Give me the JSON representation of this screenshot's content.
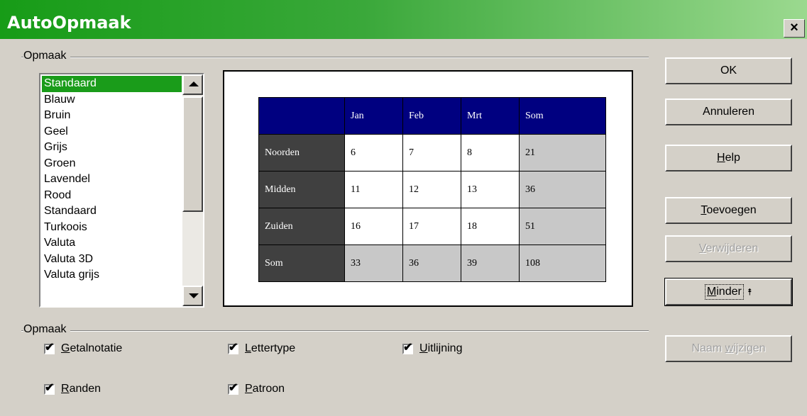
{
  "window": {
    "title": "AutoOpmaak",
    "close_glyph": "×"
  },
  "format_group": {
    "label": "Opmaak"
  },
  "format_list": {
    "items": [
      "Standaard",
      "Blauw",
      "Bruin",
      "Geel",
      "Grijs",
      "Groen",
      "Lavendel",
      "Rood",
      "Standaard",
      "Turkoois",
      "Valuta",
      "Valuta 3D",
      "Valuta grijs"
    ],
    "selected_index": 0
  },
  "preview": {
    "header": [
      "",
      "Jan",
      "Feb",
      "Mrt",
      "Som"
    ],
    "rows": [
      [
        "Noorden",
        "6",
        "7",
        "8",
        "21"
      ],
      [
        "Midden",
        "11",
        "12",
        "13",
        "36"
      ],
      [
        "Zuiden",
        "16",
        "17",
        "18",
        "51"
      ],
      [
        "Som",
        "33",
        "36",
        "39",
        "108"
      ]
    ]
  },
  "buttons": {
    "ok": "OK",
    "cancel": "Annuleren",
    "help_pre": "",
    "help_key": "H",
    "help_post": "elp",
    "add_pre": "",
    "add_key": "T",
    "add_post": "oevoegen",
    "delete_pre": "",
    "delete_key": "V",
    "delete_post": "erwijderen",
    "less_pre": "",
    "less_key": "M",
    "less_post": "inder",
    "less_arrow": "⯭",
    "rename_pre": "Naam ",
    "rename_key": "w",
    "rename_post": "ijzigen"
  },
  "options_group": {
    "label": "Opmaak",
    "options": [
      {
        "key": "G",
        "rest": "etalnotatie",
        "checked": true
      },
      {
        "key": "L",
        "rest": "ettertype",
        "checked": true
      },
      {
        "key": "U",
        "rest": "itlijning",
        "checked": true
      },
      {
        "key": "R",
        "rest": "anden",
        "checked": true
      },
      {
        "key": "P",
        "rest": "atroon",
        "checked": true
      }
    ]
  },
  "check_glyph": "✔"
}
